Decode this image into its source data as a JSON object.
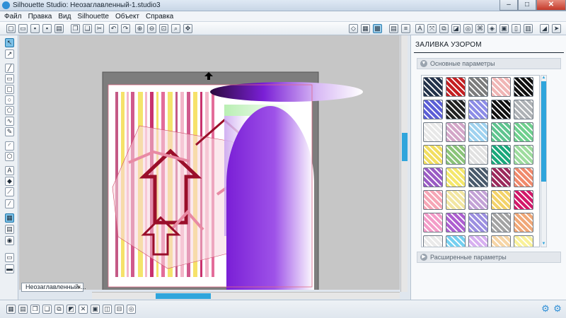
{
  "window": {
    "title": "Silhouette Studio: Неозаглавленный-1.studio3"
  },
  "menu": [
    "Файл",
    "Правка",
    "Вид",
    "Silhouette",
    "Объект",
    "Справка"
  ],
  "toolbar_icons": [
    "new-document",
    "open",
    "save",
    "save-as",
    "print",
    "cut-settings",
    "copy",
    "paste",
    "cut",
    "undo",
    "redo",
    "zoom-in",
    "zoom-out",
    "zoom-fit",
    "zoom-box",
    "pan",
    "page-setup",
    "grid",
    "registration",
    "fill-color",
    "line-color",
    "text-style",
    "transform",
    "replicate",
    "modify",
    "offset",
    "trace",
    "point-edit",
    "store",
    "cut-style",
    "send"
  ],
  "left_tools": [
    "select",
    "point-edit",
    "line",
    "rectangle",
    "rounded-rectangle",
    "ellipse",
    "polygon",
    "curve",
    "arc",
    "regular-polygon",
    "text",
    "eraser",
    "knife",
    "library",
    "store",
    "design-store",
    "cut-window"
  ],
  "document_tab": {
    "label": "Неозаглавленный-...",
    "close": "x"
  },
  "panel": {
    "title": "ЗАЛИВКА УЗОРОМ",
    "basic_section": "Основные параметры",
    "advanced_section": "Расширенные параметры"
  },
  "swatches": [
    "#23324a",
    "#c41f22",
    "#7c7c7c",
    "#f0b6b6",
    "#111111",
    "#5c5fd6",
    "#222222",
    "#8c8ce6",
    "#111111",
    "#aeb2b6",
    "#e8e8e8",
    "#d3a6c8",
    "#9fd2ef",
    "#5fc48f",
    "#6fcf8e",
    "#f2de62",
    "#8bc47a",
    "#e1e1e1",
    "#1aa87b",
    "#9edc9e",
    "#9a5cc4",
    "#f4e76c",
    "#4a5a6b",
    "#9b2a5c",
    "#f08a6c",
    "#f6a6b6",
    "#f2e6a2",
    "#c3a2d6",
    "#f3d36a",
    "#d2196a",
    "#f39cc8",
    "#ad5fd0",
    "#9c8fe0",
    "#a3a3a3",
    "#f0a878",
    "#eaeaea",
    "#74d0f0",
    "#d7b0f0",
    "#f6d5a6",
    "#f9f19a"
  ],
  "bottom_icons": [
    "group",
    "ungroup",
    "compound-path",
    "release-compound",
    "weld",
    "subtract",
    "intersect",
    "crop",
    "divide",
    "lock",
    "unlock",
    "modify-settings"
  ],
  "colors": {
    "accent": "#2fa5dc",
    "canvas_bg": "#c6c6c6"
  }
}
